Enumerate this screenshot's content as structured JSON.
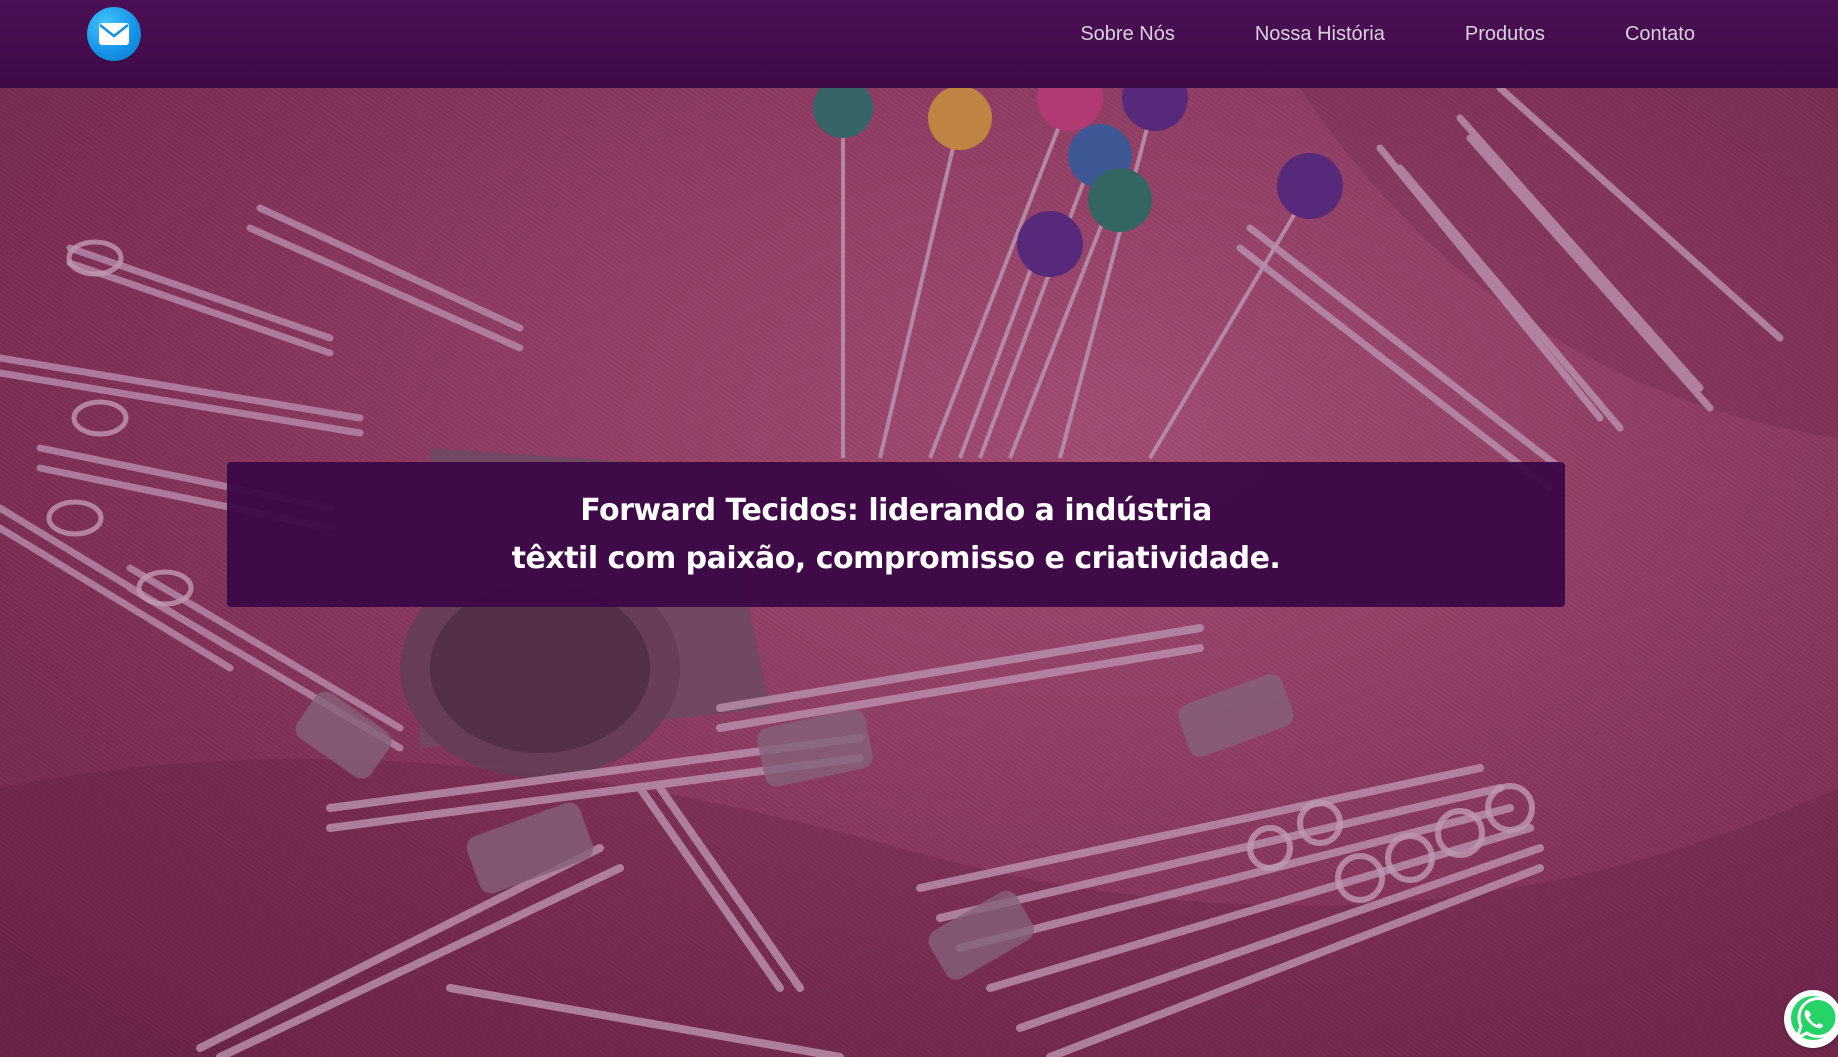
{
  "header": {
    "logo_icon": "mail-icon",
    "nav": [
      {
        "label": "Sobre Nós"
      },
      {
        "label": "Nossa História"
      },
      {
        "label": "Produtos"
      },
      {
        "label": "Contato"
      }
    ]
  },
  "hero": {
    "background_image": "sewing pins and safety pins on pink fabric",
    "tagline_line1": "Forward Tecidos: liderando a indústria",
    "tagline_line2": "têxtil com paixão, compromisso e criatividade."
  },
  "floating": {
    "whatsapp_icon": "whatsapp-icon"
  },
  "colors": {
    "navbar": "#4b0f55",
    "tagline_bg": "#3c0848",
    "hero_tint": "#9a4568",
    "logo": "#1591e6",
    "whatsapp": "#25d366"
  }
}
